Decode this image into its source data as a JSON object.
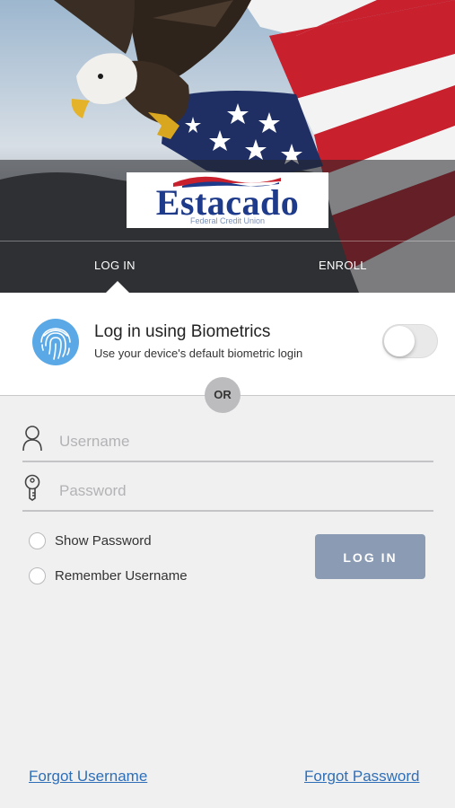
{
  "logo": {
    "name": "Estacado",
    "subtitle": "Federal Credit Union"
  },
  "tabs": [
    {
      "label": "LOG IN",
      "active": true
    },
    {
      "label": "ENROLL",
      "active": false
    }
  ],
  "biometrics": {
    "title": "Log in using Biometrics",
    "subtitle": "Use your device's default biometric login",
    "enabled": false,
    "icon": "fingerprint-icon"
  },
  "divider": {
    "label": "OR"
  },
  "form": {
    "username": {
      "placeholder": "Username",
      "value": "",
      "icon": "user-icon"
    },
    "password": {
      "placeholder": "Password",
      "value": "",
      "icon": "key-icon"
    },
    "show_password": {
      "label": "Show Password",
      "checked": false
    },
    "remember_username": {
      "label": "Remember Username",
      "checked": false
    },
    "submit_label": "LOG IN"
  },
  "links": {
    "forgot_username": "Forgot Username",
    "forgot_password": "Forgot Password"
  },
  "colors": {
    "brand_blue": "#1e3a8a",
    "button": "#8a9bb3",
    "link": "#2f6fb8"
  }
}
